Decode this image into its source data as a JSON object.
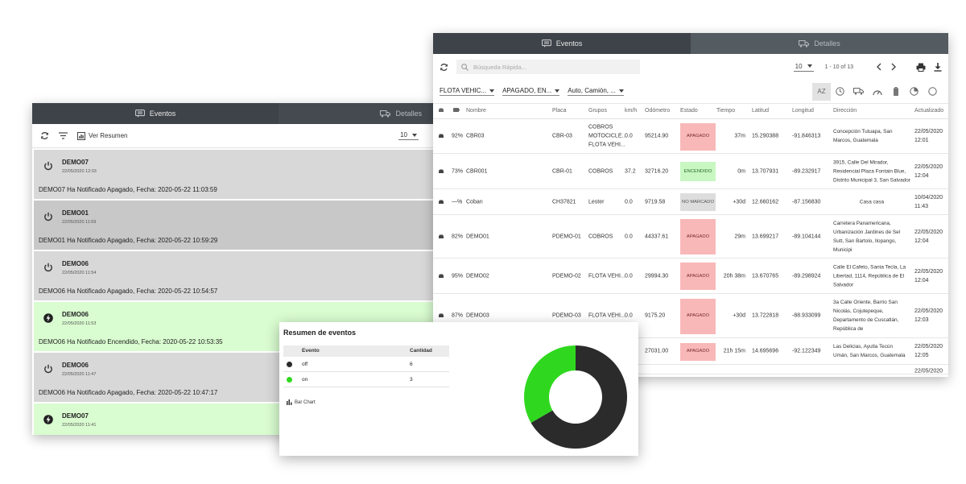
{
  "colors": {
    "tab_bg": "#444a50",
    "event_off": "#d8d8d8",
    "event_on": "#d9fcd0",
    "badge_off": "#f8b8b8",
    "badge_on": "#c8f7c2",
    "badge_nm": "#dddddd",
    "chart_off": "#2b2b2b",
    "chart_on": "#2fd81f"
  },
  "left": {
    "tab_eventos": "Eventos",
    "tab_detalles": "Detalles",
    "ver_resumen": "Ver Resumen",
    "per_page": "10",
    "events": [
      {
        "name": "DEMO07",
        "date": "22/05/2020 12:03",
        "msg": "DEMO07 Ha Notificado Apagado, Fecha: 2020-05-22 11:03:59",
        "state": "off"
      },
      {
        "name": "DEMO01",
        "date": "22/05/2020 11:59",
        "msg": "DEMO01 Ha Notificado Apagado, Fecha: 2020-05-22 10:59:29",
        "state": "off"
      },
      {
        "name": "DEMO06",
        "date": "22/05/2020 11:54",
        "msg": "DEMO06 Ha Notificado Apagado, Fecha: 2020-05-22 10:54:57",
        "state": "off"
      },
      {
        "name": "DEMO06",
        "date": "22/05/2020 11:53",
        "msg": "DEMO06 Ha Notificado Encendido, Fecha: 2020-05-22 10:53:35",
        "state": "on"
      },
      {
        "name": "DEMO06",
        "date": "22/05/2020 11:47",
        "msg": "DEMO06 Ha Notificado Apagado, Fecha: 2020-05-22 10:47:17",
        "state": "off"
      },
      {
        "name": "DEMO07",
        "date": "22/05/2020 11:41",
        "msg": "",
        "state": "on"
      }
    ]
  },
  "right": {
    "tab_eventos": "Eventos",
    "tab_detalles": "Detalles",
    "search_placeholder": "Búsqueda Rápida...",
    "per_page": "10",
    "pagination": "1 - 10 of 13",
    "filters": [
      "FLOTA VEHIC...",
      "APAGADO, EN...",
      "Auto, Camión, ..."
    ],
    "sort_icon": "AZ",
    "columns": {
      "nombre": "Nombre",
      "placa": "Placa",
      "grupos": "Grupos",
      "kmh": "km/h",
      "odometro": "Odómetro",
      "estado": "Estado",
      "tiempo": "Tiempo",
      "latitud": "Latitud",
      "longitud": "Longitud",
      "direccion": "Dirección",
      "actualizado": "Actualizado"
    },
    "rows": [
      {
        "battery": "92%",
        "name": "CBR03",
        "placa": "CBR-03",
        "grupos": [
          "COBROS",
          "MOTOCICLE...",
          "FLOTA VEHI..."
        ],
        "kmh": "0.0",
        "odo": "95214.90",
        "estado": "APAGADO",
        "state": "off",
        "tiempo": "37m",
        "lat": "15.290388",
        "lon": "-91.846313",
        "dir": [
          "Concepción Tutuapa, San",
          "Marcos, Guatemala"
        ],
        "act": [
          "22/05/2020",
          "12:01"
        ]
      },
      {
        "battery": "73%",
        "name": "CBR001",
        "placa": "CBR-01",
        "grupos": [
          "COBROS"
        ],
        "kmh": "37.2",
        "odo": "32716.20",
        "estado": "ENCENDIDO",
        "state": "on",
        "tiempo": "0m",
        "lat": "13.707931",
        "lon": "-89.232917",
        "dir": [
          "3915, Calle Del Mirador,",
          "Residencial Plaza Fontain Blue,",
          "Distrito Municipal 3, San Salvador"
        ],
        "act": [
          "22/05/2020",
          "12:04"
        ]
      },
      {
        "battery": "—%",
        "name": "Coban",
        "placa": "CH37821",
        "grupos": [
          "Lester"
        ],
        "kmh": "0.0",
        "odo": "9719.58",
        "estado": "NO MARCADO",
        "state": "nm",
        "tiempo": "+30d",
        "lat": "12.660162",
        "lon": "-87.156830",
        "dir": [
          "Casa casa"
        ],
        "act": [
          "10/04/2020",
          "11:43"
        ]
      },
      {
        "battery": "82%",
        "name": "DEMO01",
        "placa": "PDEMO-01",
        "grupos": [
          "COBROS"
        ],
        "kmh": "0.0",
        "odo": "44337.61",
        "estado": "APAGADO",
        "state": "off",
        "tiempo": "29m",
        "lat": "13.699217",
        "lon": "-89.104144",
        "dir": [
          "Carretera Panamericana,",
          "Urbanización Jardines de Sel",
          "Sutt, San Bartolo, Ilopango,",
          "Municipi"
        ],
        "act": [
          "22/05/2020",
          "12:04"
        ]
      },
      {
        "battery": "95%",
        "name": "DEMO02",
        "placa": "PDEMO-02",
        "grupos": [
          "FLOTA VEHI..."
        ],
        "kmh": "0.0",
        "odo": "29994.30",
        "estado": "APAGADO",
        "state": "off",
        "tiempo": "20h 38m",
        "lat": "13.670765",
        "lon": "-89.298924",
        "dir": [
          "Calle El Cafeto, Santa Tecla, La",
          "Libertad, 1114, República de El",
          "Salvador"
        ],
        "act": [
          "22/05/2020",
          "12:04"
        ]
      },
      {
        "battery": "87%",
        "name": "DEMO03",
        "placa": "PDEMO-03",
        "grupos": [
          "FLOTA VEHI..."
        ],
        "kmh": "0.0",
        "odo": "9175.20",
        "estado": "APAGADO",
        "state": "off",
        "tiempo": "+30d",
        "lat": "13.722818",
        "lon": "-88.933099",
        "dir": [
          "3a Calle Oriente, Barrio San",
          "Nicolás, Cojutepeque,",
          "Departamento de Cuscatlán,",
          "República de"
        ],
        "act": [
          "22/05/2020",
          "12:03"
        ]
      },
      {
        "battery": "",
        "name": "",
        "placa": "",
        "grupos": [
          ""
        ],
        "kmh": "",
        "odo": "27031.00",
        "estado": "APAGADO",
        "state": "off",
        "tiempo": "21h 15m",
        "lat": "14.695696",
        "lon": "-92.122349",
        "dir": [
          "Las Delicias, Ayutla Tecún",
          "Umán, San Marcos, Guatemala"
        ],
        "act": [
          "22/05/2020",
          "12:05"
        ]
      }
    ],
    "partial_act": "22/05/2020"
  },
  "summary": {
    "title": "Resumen de eventos",
    "col_evento": "Evento",
    "col_cantidad": "Cantidad",
    "bar_chart_label": "Bar Chart"
  },
  "chart_data": {
    "type": "pie",
    "categories": [
      "off",
      "on"
    ],
    "values": [
      6,
      3
    ],
    "colors": [
      "#2b2b2b",
      "#2fd81f"
    ],
    "donut": true
  }
}
